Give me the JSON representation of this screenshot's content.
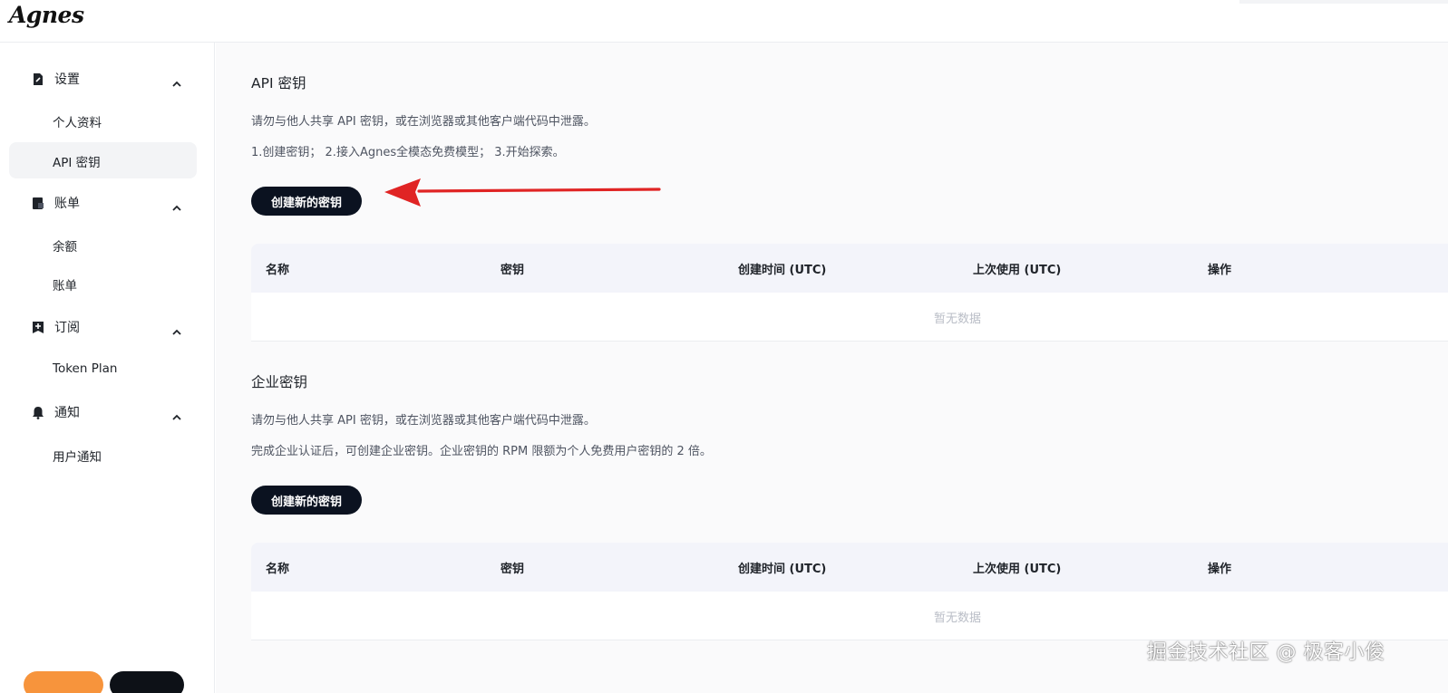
{
  "app": {
    "logo": "Agnes"
  },
  "sidebar": {
    "sections": [
      {
        "label": "设置",
        "icon": "settings-doc-icon",
        "items": [
          "个人资料",
          "API 密钥"
        ]
      },
      {
        "label": "账单",
        "icon": "billing-icon",
        "items": [
          "余额",
          "账单"
        ]
      },
      {
        "label": "订阅",
        "icon": "subscribe-icon",
        "items": [
          "Token Plan"
        ]
      },
      {
        "label": "通知",
        "icon": "bell-icon",
        "items": [
          "用户通知"
        ]
      }
    ],
    "active_item": "API 密钥"
  },
  "api_keys": {
    "title": "API 密钥",
    "warning": "请勿与他人共享 API 密钥，或在浏览器或其他客户端代码中泄露。",
    "steps": "1.创建密钥； 2.接入Agnes全模态免费模型； 3.开始探索。",
    "create_button": "创建新的密钥",
    "table": {
      "columns": [
        "名称",
        "密钥",
        "创建时间 (UTC)",
        "上次使用 (UTC)",
        "操作"
      ],
      "empty": "暂无数据"
    }
  },
  "enterprise_keys": {
    "title": "企业密钥",
    "warning": "请勿与他人共享 API 密钥，或在浏览器或其他客户端代码中泄露。",
    "note": "完成企业认证后，可创建企业密钥。企业密钥的 RPM 限额为个人免费用户密钥的 2 倍。",
    "create_button": "创建新的密钥",
    "table": {
      "columns": [
        "名称",
        "密钥",
        "创建时间 (UTC)",
        "上次使用 (UTC)",
        "操作"
      ],
      "empty": "暂无数据"
    }
  },
  "watermark": "掘金技术社区 @ 极客小俊",
  "colors": {
    "primary_button": "#0b1220",
    "arrow": "#e02424",
    "active_nav": "#f3f4f6",
    "table_header": "#f3f4fa"
  }
}
